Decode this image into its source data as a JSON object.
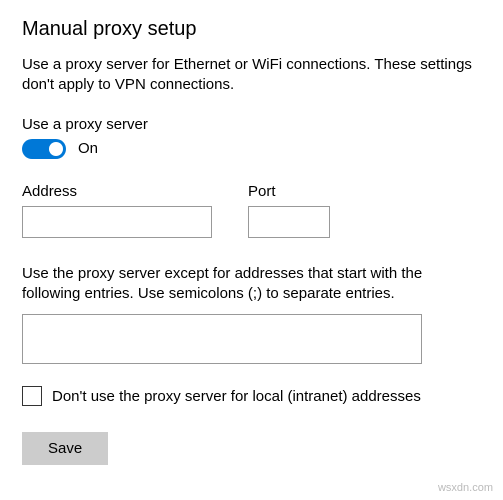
{
  "title": "Manual proxy setup",
  "description": "Use a proxy server for Ethernet or WiFi connections. These settings don't apply to VPN connections.",
  "use_proxy": {
    "label": "Use a proxy server",
    "state_text": "On",
    "on": true
  },
  "address": {
    "label": "Address",
    "value": ""
  },
  "port": {
    "label": "Port",
    "value": ""
  },
  "exceptions": {
    "description": "Use the proxy server except for addresses that start with the following entries. Use semicolons (;) to separate entries.",
    "value": ""
  },
  "local_bypass": {
    "label": "Don't use the proxy server for local (intranet) addresses",
    "checked": false
  },
  "save_label": "Save",
  "watermark": "wsxdn.com"
}
